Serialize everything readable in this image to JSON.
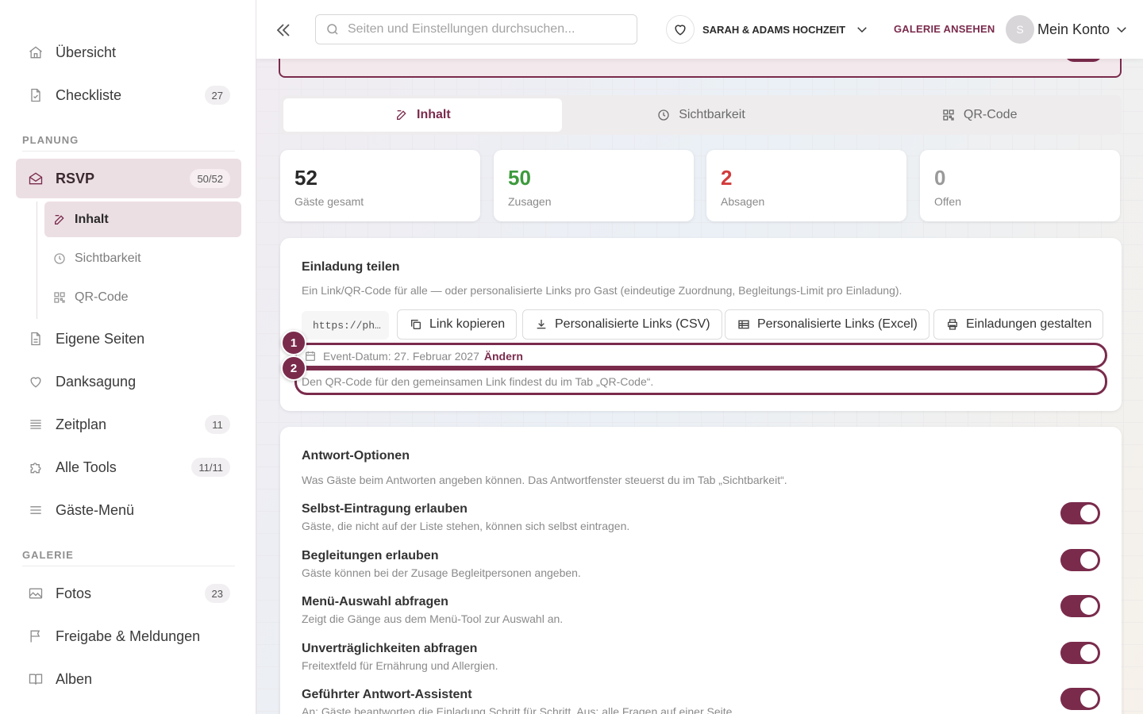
{
  "sidebar": {
    "items": [
      {
        "label": "Übersicht",
        "icon": "home-icon"
      },
      {
        "label": "Checkliste",
        "icon": "document-icon",
        "badge": "27"
      }
    ],
    "sections": {
      "planung": "PLANUNG",
      "galerie": "GALERIE"
    },
    "rsvp": {
      "label": "RSVP",
      "badge": "50/52",
      "icon": "envelope-icon"
    },
    "rsvp_sub": [
      {
        "label": "Inhalt",
        "icon": "edit-icon"
      },
      {
        "label": "Sichtbarkeit",
        "icon": "clock-icon"
      },
      {
        "label": "QR-Code",
        "icon": "qr-code-icon"
      }
    ],
    "planning_items": [
      {
        "label": "Eigene Seiten",
        "icon": "document-icon"
      },
      {
        "label": "Danksagung",
        "icon": "heart-icon"
      },
      {
        "label": "Zeitplan",
        "icon": "list-icon",
        "badge": "11"
      },
      {
        "label": "Alle Tools",
        "icon": "puzzle-icon",
        "badge": "11/11"
      },
      {
        "label": "Gäste-Menü",
        "icon": "menu-icon"
      }
    ],
    "gallery_items": [
      {
        "label": "Fotos",
        "icon": "image-icon",
        "badge": "23"
      },
      {
        "label": "Freigabe & Meldungen",
        "icon": "flag-icon"
      },
      {
        "label": "Alben",
        "icon": "book-icon"
      }
    ]
  },
  "topbar": {
    "search_placeholder": "Seiten und Einstellungen durchsuchen...",
    "event_name": "SARAH & ADAMS HOCHZEIT",
    "gallery_link": "GALERIE ANSEHEN",
    "avatar_initial": "S",
    "account_label": "Mein Konto"
  },
  "tabs": [
    {
      "label": "Inhalt",
      "icon": "edit-icon"
    },
    {
      "label": "Sichtbarkeit",
      "icon": "clock-icon"
    },
    {
      "label": "QR-Code",
      "icon": "qr-code-icon"
    }
  ],
  "stats": [
    {
      "value": "52",
      "label": "Gäste gesamt",
      "color": "#2a2a2a"
    },
    {
      "value": "50",
      "label": "Zusagen",
      "color": "#3c9a3c"
    },
    {
      "value": "2",
      "label": "Absagen",
      "color": "#d33b3b"
    },
    {
      "value": "0",
      "label": "Offen",
      "color": "#9a9a9a"
    }
  ],
  "share": {
    "title": "Einladung teilen",
    "desc": "Ein Link/QR-Code für alle — oder personalisierte Links pro Gast (eindeutige Zuordnung, Begleitungs-Limit pro Einladung).",
    "link": "https://ph…",
    "buttons": [
      {
        "label": "Link kopieren",
        "icon": "copy-icon"
      },
      {
        "label": "Personalisierte Links (CSV)",
        "icon": "download-icon"
      },
      {
        "label": "Personalisierte Links (Excel)",
        "icon": "table-icon"
      },
      {
        "label": "Einladungen gestalten",
        "icon": "printer-icon"
      }
    ],
    "event_date": "Event-Datum: 27. Februar 2027",
    "change": "Ändern",
    "qr_hint": "Den QR-Code für den gemeinsamen Link findest du im Tab „QR-Code“.",
    "markers": [
      "1",
      "2"
    ]
  },
  "options": {
    "title": "Antwort-Optionen",
    "desc": "Was Gäste beim Antworten angeben können. Das Antwortfenster steuerst du im Tab „Sichtbarkeit“.",
    "items": [
      {
        "title": "Selbst-Eintragung erlauben",
        "desc": "Gäste, die nicht auf der Liste stehen, können sich selbst eintragen.",
        "enabled": true
      },
      {
        "title": "Begleitungen erlauben",
        "desc": "Gäste können bei der Zusage Begleitpersonen angeben.",
        "enabled": true
      },
      {
        "title": "Menü-Auswahl abfragen",
        "desc": "Zeigt die Gänge aus dem Menü-Tool zur Auswahl an.",
        "enabled": true
      },
      {
        "title": "Unverträglichkeiten abfragen",
        "desc": "Freitextfeld für Ernährung und Allergien.",
        "enabled": true
      },
      {
        "title": "Geführter Antwort-Assistent",
        "desc": "An: Gäste beantworten die Einladung Schritt für Schritt. Aus: alle Fragen auf einer Seite.",
        "enabled": true
      }
    ]
  },
  "colors": {
    "accent": "#7a2b4c",
    "accept": "#3c9a3c",
    "decline": "#d33b3b"
  }
}
